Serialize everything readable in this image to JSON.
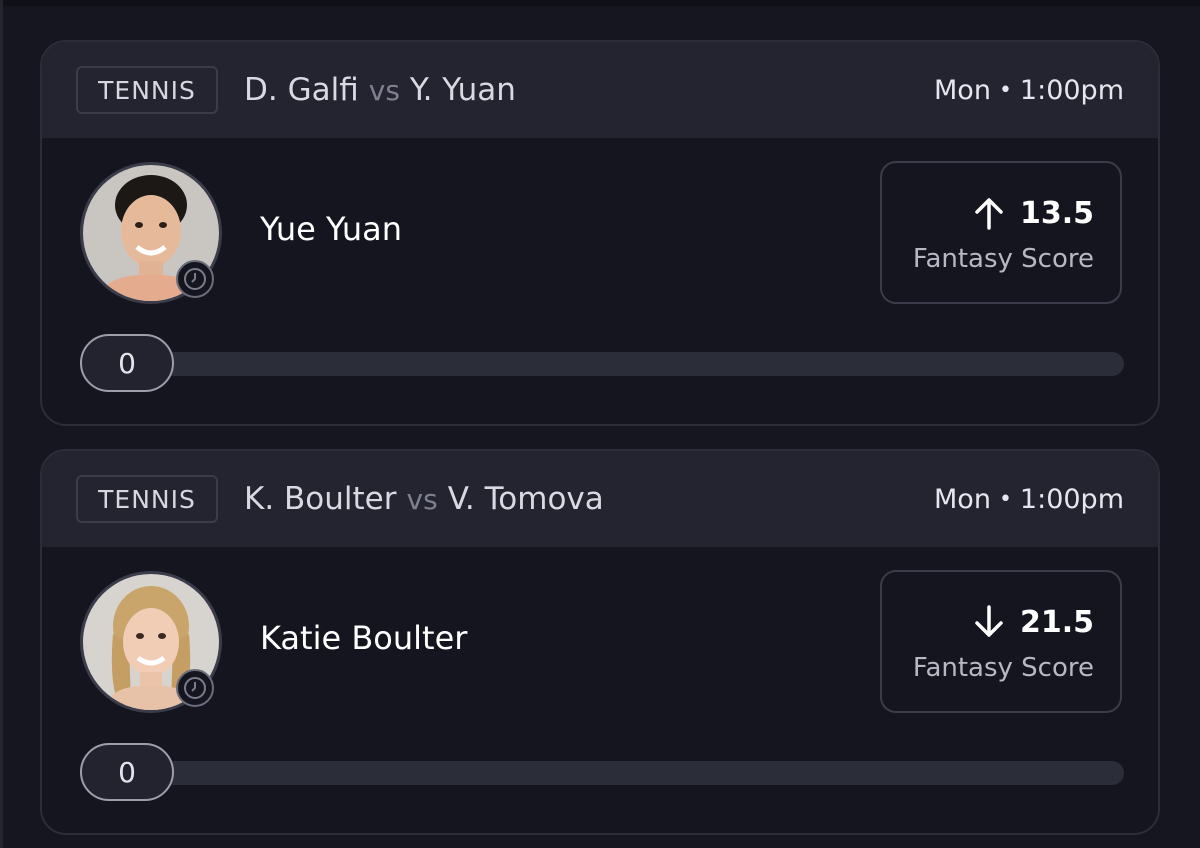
{
  "cards": [
    {
      "sport": "TENNIS",
      "player_a": "D. Galfi",
      "vs": "vs",
      "player_b": "Y. Yuan",
      "day": "Mon",
      "time": "1:00pm",
      "player_name": "Yue Yuan",
      "direction": "up",
      "line_value": "13.5",
      "stat_label": "Fantasy Score",
      "progress_value": "0",
      "progress_fraction": 0
    },
    {
      "sport": "TENNIS",
      "player_a": "K. Boulter",
      "vs": "vs",
      "player_b": "V. Tomova",
      "day": "Mon",
      "time": "1:00pm",
      "player_name": "Katie Boulter",
      "direction": "down",
      "line_value": "21.5",
      "stat_label": "Fantasy Score",
      "progress_value": "0",
      "progress_fraction": 0
    }
  ],
  "icons": {
    "up": "arrow-up-icon",
    "down": "arrow-down-icon",
    "clock": "clock-icon"
  },
  "colors": {
    "background": "#15161f",
    "card_header": "#23242f",
    "border": "#3a3c49",
    "text_muted": "#b6b8c4"
  }
}
